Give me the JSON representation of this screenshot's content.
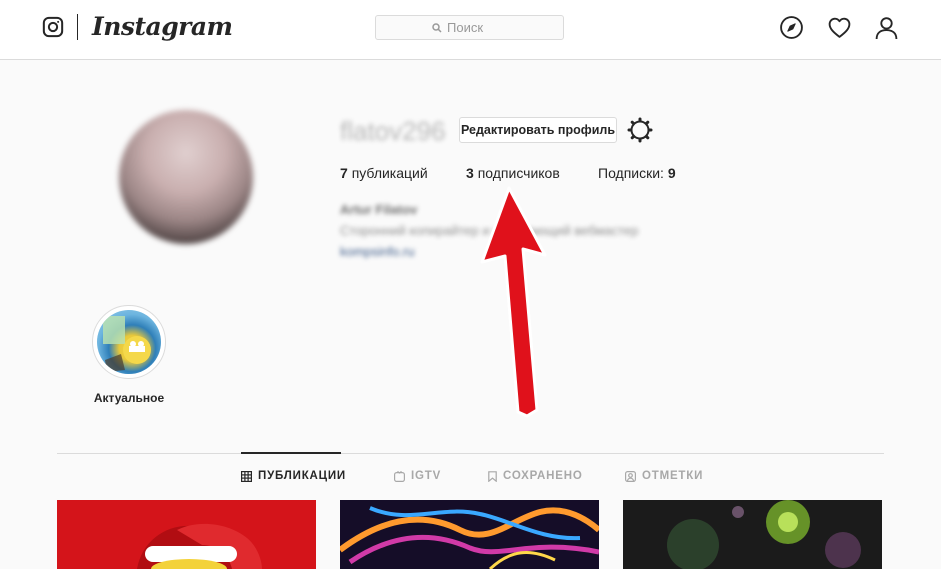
{
  "header": {
    "brand": "Instagram",
    "search_placeholder": "Поиск",
    "nav_icons": [
      "compass-icon",
      "heart-icon",
      "user-icon"
    ]
  },
  "profile": {
    "username": "flatov296",
    "edit_button": "Редактировать профиль",
    "stats": {
      "posts_count": "7",
      "posts_label": "публикаций",
      "followers_count": "3",
      "followers_label": "подписчиков",
      "following_label": "Подписки:",
      "following_count": "9"
    },
    "bio": {
      "name": "Artur Filatov",
      "text": "Сторонний копирайтер и начинающий вебмастер",
      "link": "kompsinfo.ru"
    }
  },
  "highlights": [
    {
      "label": "Актуальное"
    }
  ],
  "tabs": [
    {
      "label": "ПУБЛИКАЦИИ",
      "icon": "grid-icon",
      "active": true
    },
    {
      "label": "IGTV",
      "icon": "igtv-icon",
      "active": false
    },
    {
      "label": "СОХРАНЕНО",
      "icon": "bookmark-icon",
      "active": false
    },
    {
      "label": "ОТМЕТКИ",
      "icon": "tag-icon",
      "active": false
    }
  ],
  "colors": {
    "accent_annotation": "#e0111b",
    "border": "#dbdbdb",
    "text": "#262626",
    "muted": "#8e8e8e"
  }
}
